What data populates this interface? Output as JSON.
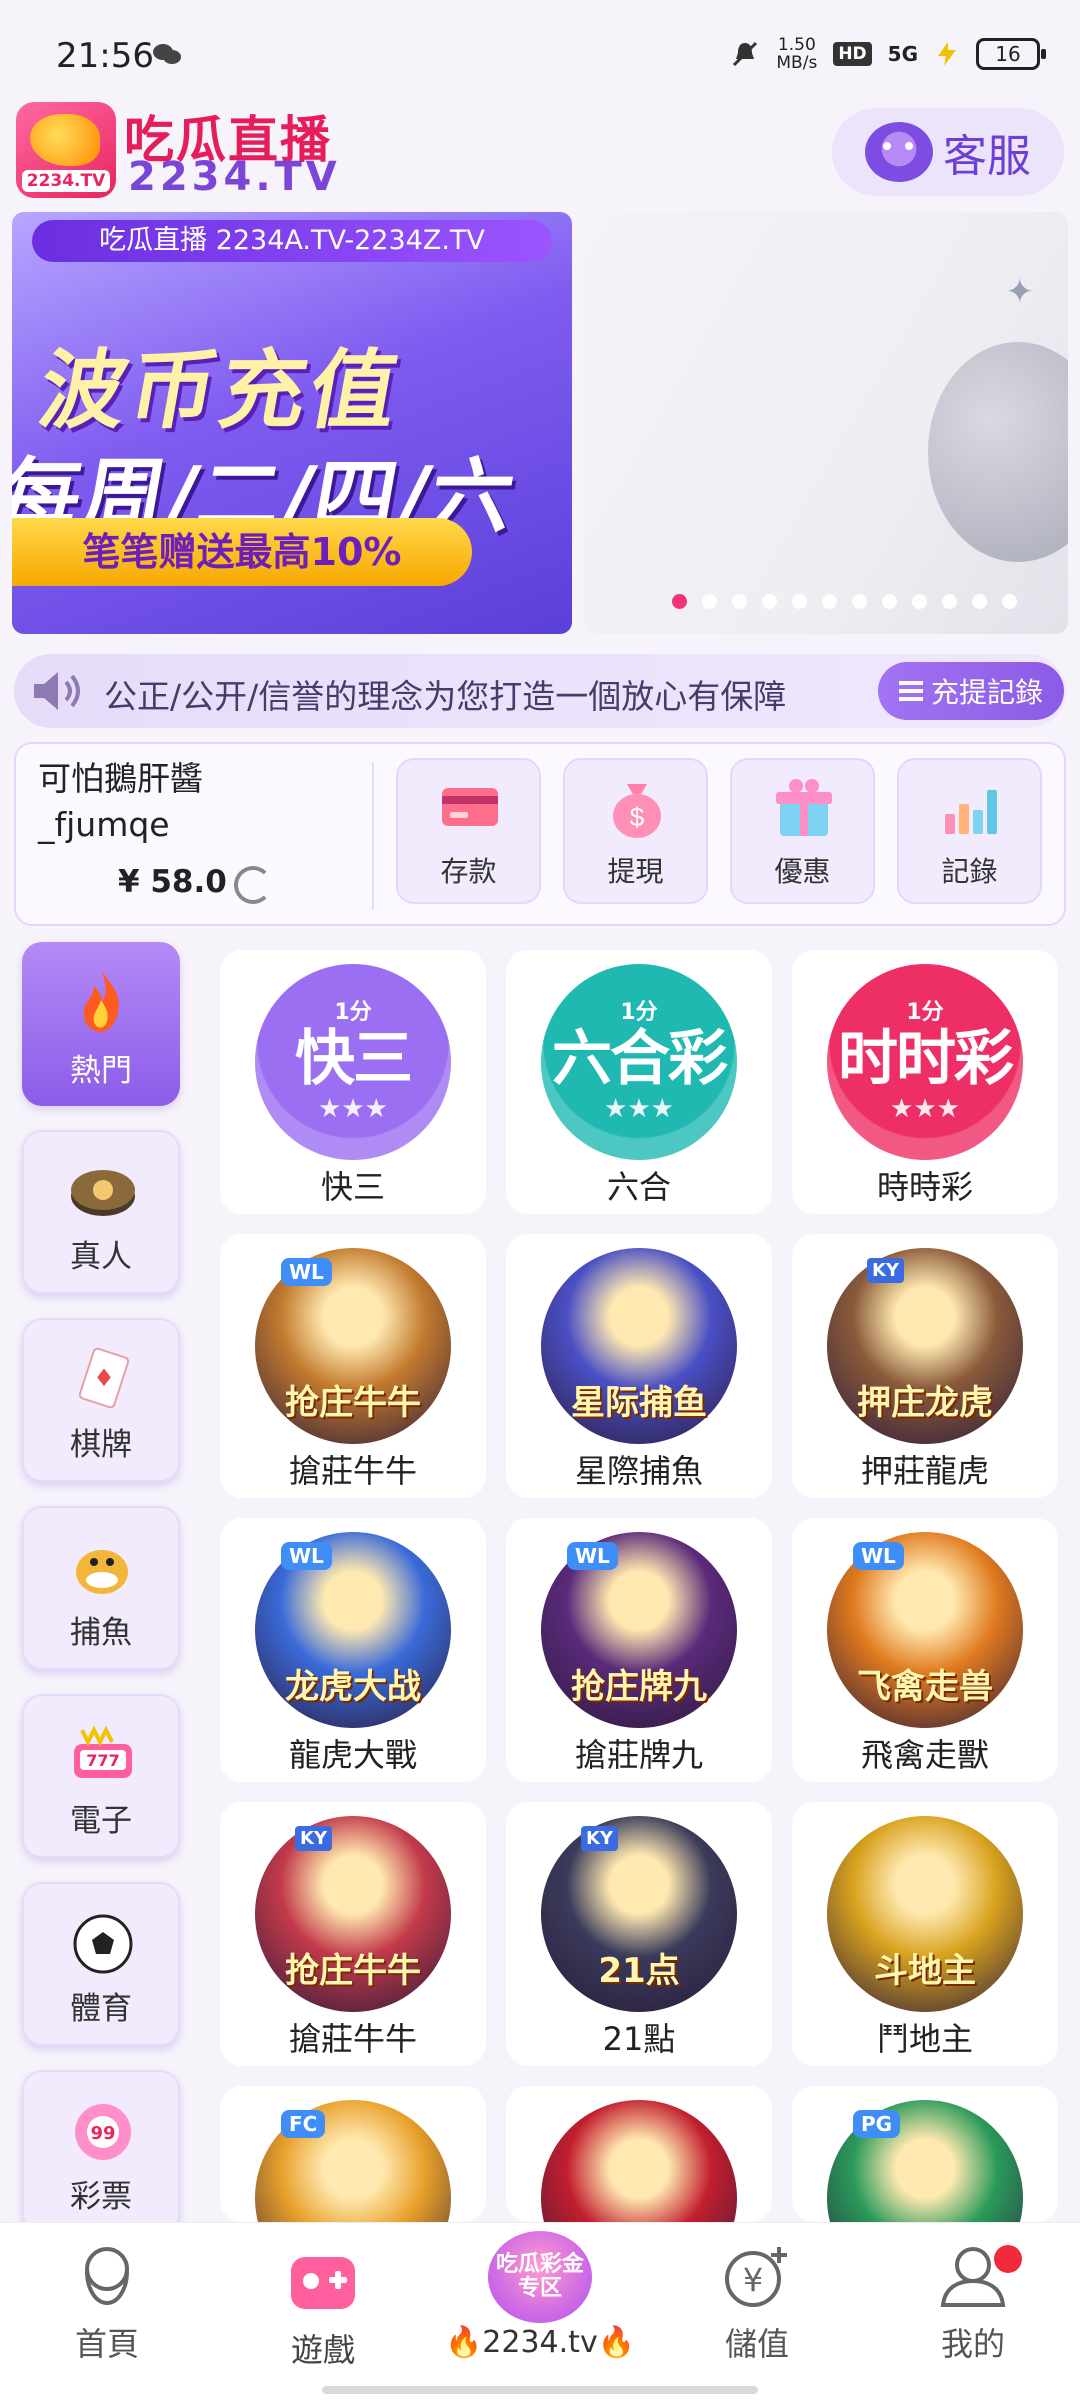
{
  "status_bar": {
    "time": "21:56",
    "network_speed_value": "1.50",
    "network_speed_unit": "MB/s",
    "hd_badge": "HD",
    "signal_label": "5G",
    "battery_level": "16"
  },
  "header": {
    "logo_tv_text": "2234.TV",
    "brand_cn": "吃瓜直播",
    "brand_en": "2234.TV",
    "service_label": "客服"
  },
  "banner": {
    "slide1_top": "吃瓜直播 2234A.TV-2234Z.TV",
    "slide1_title": "波币充值",
    "slide1_days": "每周/二/四/六",
    "slide1_pill": "笔笔赠送最高10%",
    "slide_count": 12,
    "active_slide": 1
  },
  "notice": {
    "text": "公正/公开/信誉的理念为您打造一個放心有保障",
    "record_button": "充提記錄"
  },
  "account": {
    "name_line1": "可怕鵝肝醬",
    "name_line2": "_fjumqe",
    "balance": "¥ 58.0",
    "actions": [
      {
        "label": "存款",
        "icon": "card-icon"
      },
      {
        "label": "提現",
        "icon": "money-bag-icon"
      },
      {
        "label": "優惠",
        "icon": "gift-icon"
      },
      {
        "label": "記錄",
        "icon": "bar-chart-icon"
      }
    ]
  },
  "categories": [
    {
      "label": "熱門",
      "icon": "flame-icon",
      "active": true
    },
    {
      "label": "真人",
      "icon": "casino-chip-icon"
    },
    {
      "label": "棋牌",
      "icon": "playing-card-icon"
    },
    {
      "label": "捕魚",
      "icon": "shark-icon"
    },
    {
      "label": "電子",
      "icon": "slot-machine-icon"
    },
    {
      "label": "體育",
      "icon": "soccer-ball-icon"
    },
    {
      "label": "彩票",
      "icon": "lottery-ball-icon"
    }
  ],
  "games": [
    {
      "title": "快三",
      "badge_top": "1分",
      "badge_main": "快三",
      "color": "#9b6ff2"
    },
    {
      "title": "六合",
      "badge_top": "1分",
      "badge_main": "六合彩",
      "color": "#20b9b2"
    },
    {
      "title": "時時彩",
      "badge_top": "1分",
      "badge_main": "时时彩",
      "color": "#ee2f66"
    },
    {
      "title": "搶莊牛牛",
      "art": "抢庄牛牛",
      "tag": "WL",
      "color": "#c27a2e"
    },
    {
      "title": "星際捕魚",
      "art": "星际捕鱼",
      "color": "#4a4fc4"
    },
    {
      "title": "押莊龍虎",
      "art": "押庄龙虎",
      "tag": "KY",
      "color": "#8a5a3a"
    },
    {
      "title": "龍虎大戰",
      "art": "龙虎大战",
      "tag": "WL",
      "color": "#3a6ad8"
    },
    {
      "title": "搶莊牌九",
      "art": "抢庄牌九",
      "tag": "WL",
      "color": "#5a2a7a"
    },
    {
      "title": "飛禽走獸",
      "art": "飞禽走兽",
      "tag": "WL",
      "color": "#e07a1e"
    },
    {
      "title": "搶莊牛牛",
      "art": "抢庄牛牛",
      "tag": "KY",
      "color": "#c23a4a"
    },
    {
      "title": "21點",
      "art": "21点",
      "tag": "KY",
      "color": "#3a3a5a"
    },
    {
      "title": "鬥地主",
      "art": "斗地主",
      "color": "#d8a21e"
    },
    {
      "title": "",
      "art": "",
      "tag": "FC",
      "color": "#e8a02a"
    },
    {
      "title": "",
      "art": "",
      "color": "#c21e2e"
    },
    {
      "title": "",
      "art": "",
      "tag": "PG",
      "color": "#2a9a5a"
    }
  ],
  "bottom_nav": {
    "items": [
      {
        "label": "首頁",
        "icon": "home-avatar-icon"
      },
      {
        "label": "遊戲",
        "icon": "gamepad-icon"
      },
      {
        "label": "儲值",
        "icon": "yuan-plus-icon"
      },
      {
        "label": "我的",
        "icon": "profile-icon"
      }
    ],
    "center_badge": "吃瓜彩金专区",
    "center_label": "🔥2234.tv🔥"
  }
}
